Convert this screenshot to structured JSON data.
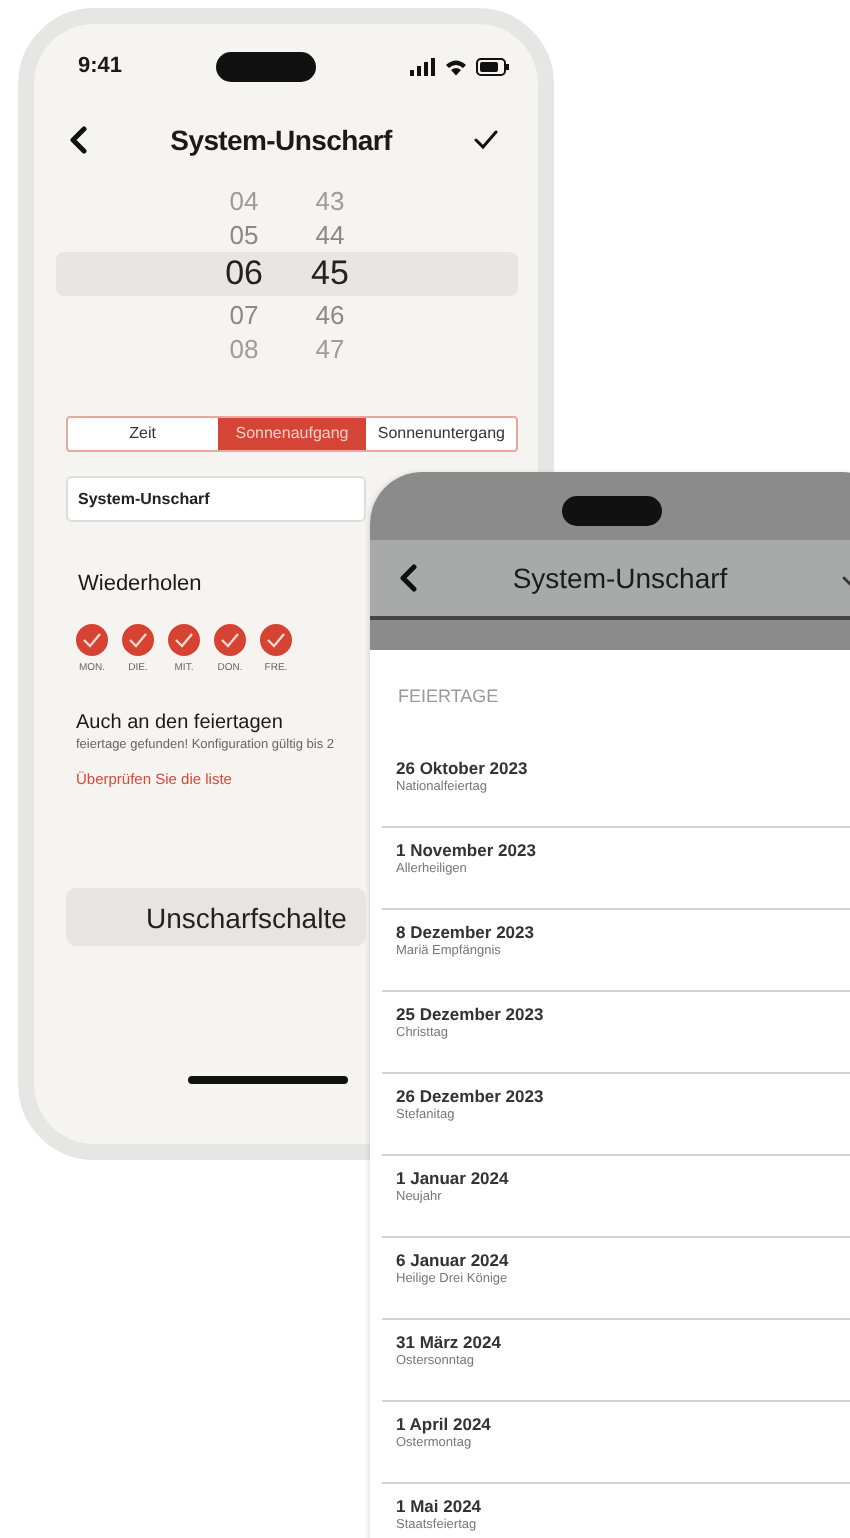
{
  "phone_back": {
    "status_bar": {
      "time": "9:41"
    },
    "nav": {
      "title": "System-Unscharf"
    },
    "picker": {
      "columns": [
        {
          "items": [
            {
              "label": "04",
              "selected": false
            },
            {
              "label": "05",
              "selected": false
            },
            {
              "label": "06",
              "selected": true
            },
            {
              "label": "07",
              "selected": false
            },
            {
              "label": "08",
              "selected": false
            }
          ]
        },
        {
          "items": [
            {
              "label": "43",
              "selected": false
            },
            {
              "label": "44",
              "selected": false
            },
            {
              "label": "45",
              "selected": true
            },
            {
              "label": "46",
              "selected": false
            },
            {
              "label": "47",
              "selected": false
            }
          ]
        }
      ]
    },
    "segments": [
      {
        "label": "Zeit",
        "selected": false
      },
      {
        "label": "Sonnenaufgang",
        "selected": true
      },
      {
        "label": "Sonnenuntergang",
        "selected": false
      }
    ],
    "name_field": {
      "value": "System-Unscharf"
    },
    "repeat": {
      "title": "Wiederholen",
      "days": [
        {
          "label": "MON.",
          "checked": true
        },
        {
          "label": "DIE.",
          "checked": true
        },
        {
          "label": "MIT.",
          "checked": true
        },
        {
          "label": "DON.",
          "checked": true
        },
        {
          "label": "FRE.",
          "checked": true
        }
      ]
    },
    "holidays_option": {
      "title": "Auch an den feiertagen",
      "note": "feiertage gefunden! Konfiguration gültig bis 2",
      "link": "Überprüfen Sie die liste"
    },
    "button": {
      "label": "Unscharfschalte"
    }
  },
  "phone_front": {
    "nav": {
      "title": "System-Unscharf"
    },
    "section_title": "FEIERTAGE",
    "holidays": [
      {
        "date": "26 Oktober 2023",
        "name": "Nationalfeiertag"
      },
      {
        "date": "1 November 2023",
        "name": "Allerheiligen"
      },
      {
        "date": "8 Dezember 2023",
        "name": "Mariä Empfängnis"
      },
      {
        "date": "25 Dezember 2023",
        "name": "Christtag"
      },
      {
        "date": "26 Dezember 2023",
        "name": "Stefanitag"
      },
      {
        "date": "1 Januar 2024",
        "name": "Neujahr"
      },
      {
        "date": "6 Januar 2024",
        "name": "Heilige Drei Könige"
      },
      {
        "date": "31 März 2024",
        "name": "Ostersonntag"
      },
      {
        "date": "1 April 2024",
        "name": "Ostermontag"
      },
      {
        "date": "1 Mai 2024",
        "name": "Staatsfeiertag"
      }
    ]
  }
}
